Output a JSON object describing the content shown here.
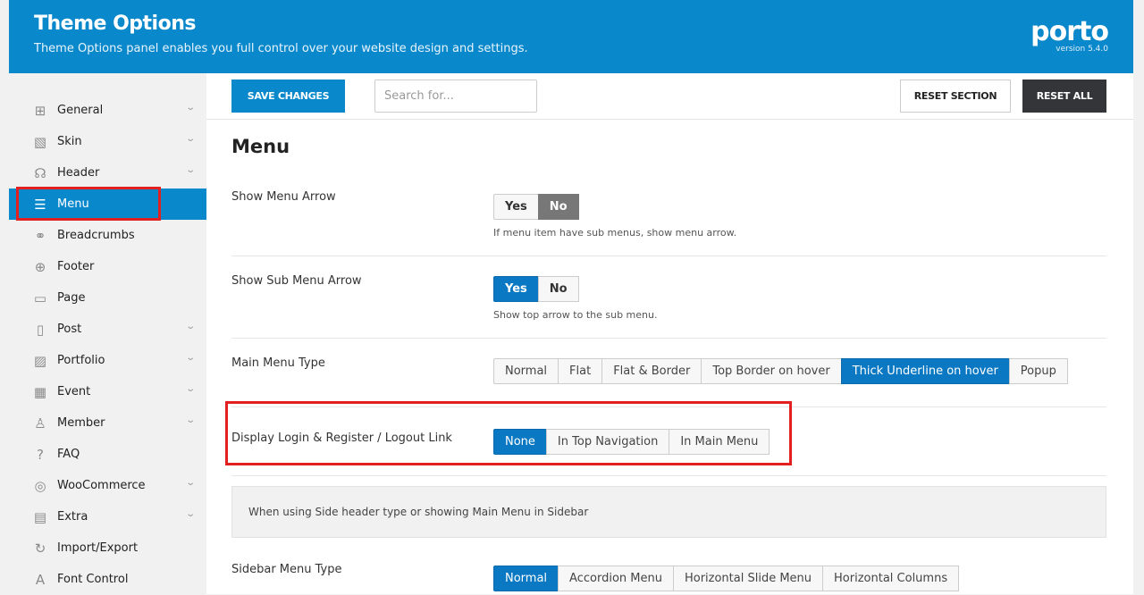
{
  "header": {
    "title": "Theme Options",
    "subtitle": "Theme Options panel enables you full control over your website design and settings.",
    "logo": "porto",
    "version": "version 5.4.0"
  },
  "sidebar": {
    "items": [
      {
        "label": "General",
        "icon": "sliders-icon",
        "glyph": "⊞",
        "chevron": true
      },
      {
        "label": "Skin",
        "icon": "paint-icon",
        "glyph": "▧",
        "chevron": true
      },
      {
        "label": "Header",
        "icon": "headphones-icon",
        "glyph": "☊",
        "chevron": true
      },
      {
        "label": "Menu",
        "icon": "hamburger-icon",
        "glyph": "☰",
        "chevron": false,
        "active": true
      },
      {
        "label": "Breadcrumbs",
        "icon": "link-icon",
        "glyph": "⚭",
        "chevron": false
      },
      {
        "label": "Footer",
        "icon": "arrow-down-circle-icon",
        "glyph": "⊕",
        "chevron": false
      },
      {
        "label": "Page",
        "icon": "browser-icon",
        "glyph": "▭",
        "chevron": false
      },
      {
        "label": "Post",
        "icon": "document-icon",
        "glyph": "▯",
        "chevron": true
      },
      {
        "label": "Portfolio",
        "icon": "image-icon",
        "glyph": "▨",
        "chevron": true
      },
      {
        "label": "Event",
        "icon": "calendar-icon",
        "glyph": "▦",
        "chevron": true
      },
      {
        "label": "Member",
        "icon": "user-icon",
        "glyph": "♙",
        "chevron": true
      },
      {
        "label": "FAQ",
        "icon": "question-icon",
        "glyph": "?",
        "chevron": false
      },
      {
        "label": "WooCommerce",
        "icon": "globe-icon",
        "glyph": "◎",
        "chevron": true
      },
      {
        "label": "Extra",
        "icon": "folder-icon",
        "glyph": "▤",
        "chevron": true
      },
      {
        "label": "Import/Export",
        "icon": "refresh-icon",
        "glyph": "↻",
        "chevron": false
      },
      {
        "label": "Font Control",
        "icon": "font-icon",
        "glyph": "A",
        "chevron": false
      }
    ]
  },
  "toolbar": {
    "save_label": "SAVE CHANGES",
    "search_placeholder": "Search for...",
    "reset_section_label": "RESET SECTION",
    "reset_all_label": "RESET ALL"
  },
  "section_title": "Menu",
  "settings": {
    "show_menu_arrow": {
      "label": "Show Menu Arrow",
      "options": [
        "Yes",
        "No"
      ],
      "selected": "No",
      "description": "If menu item have sub menus, show menu arrow."
    },
    "show_sub_menu_arrow": {
      "label": "Show Sub Menu Arrow",
      "options": [
        "Yes",
        "No"
      ],
      "selected": "Yes",
      "description": "Show top arrow to the sub menu."
    },
    "main_menu_type": {
      "label": "Main Menu Type",
      "options": [
        "Normal",
        "Flat",
        "Flat & Border",
        "Top Border on hover",
        "Thick Underline on hover",
        "Popup"
      ],
      "selected": "Thick Underline on hover"
    },
    "login_link": {
      "label": "Display Login & Register / Logout Link",
      "options": [
        "None",
        "In Top Navigation",
        "In Main Menu"
      ],
      "selected": "None"
    },
    "notice": "When using Side header type or showing Main Menu in Sidebar",
    "sidebar_menu_type": {
      "label": "Sidebar Menu Type",
      "options": [
        "Normal",
        "Accordion Menu",
        "Horizontal Slide Menu",
        "Horizontal Columns"
      ],
      "selected": "Normal"
    }
  },
  "colors": {
    "accent": "#0a88cc",
    "highlight": "#e3201f"
  }
}
